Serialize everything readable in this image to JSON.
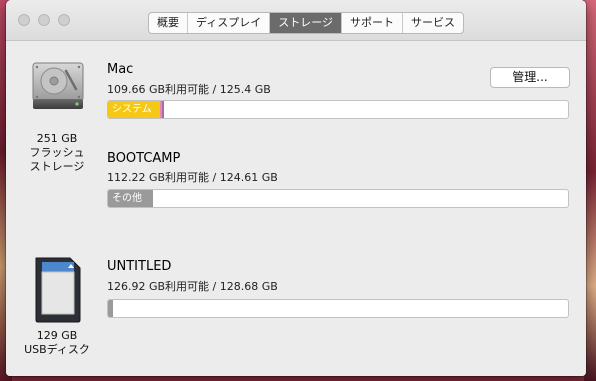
{
  "tabs": [
    {
      "label": "概要",
      "active": false
    },
    {
      "label": "ディスプレイ",
      "active": false
    },
    {
      "label": "ストレージ",
      "active": true
    },
    {
      "label": "サポート",
      "active": false
    },
    {
      "label": "サービス",
      "active": false
    }
  ],
  "disks": {
    "internal": {
      "capacity": "251 GB",
      "type_line1": "フラッシュ",
      "type_line2": "ストレージ"
    },
    "usb": {
      "capacity": "129 GB",
      "type": "USBディスク"
    }
  },
  "volumes": {
    "mac": {
      "name": "Mac",
      "info": "109.66 GB利用可能 / 125.4 GB",
      "manage_button": "管理...",
      "segments": [
        {
          "label": "システム",
          "color": "#f5c816",
          "fraction": 0.113
        },
        {
          "label": "",
          "color": "#e68aa8",
          "fraction": 0.004
        },
        {
          "label": "",
          "color": "#a86ab8",
          "fraction": 0.003
        }
      ]
    },
    "bootcamp": {
      "name": "BOOTCAMP",
      "info": "112.22 GB利用可能 / 124.61 GB",
      "segments": [
        {
          "label": "その他",
          "color": "#9a9a9a",
          "fraction": 0.097
        }
      ]
    },
    "untitled": {
      "name": "UNTITLED",
      "info": "126.92 GB利用可能 / 128.68 GB",
      "segments": [
        {
          "label": "",
          "color": "#9a9a9a",
          "fraction": 0.01
        }
      ]
    }
  }
}
